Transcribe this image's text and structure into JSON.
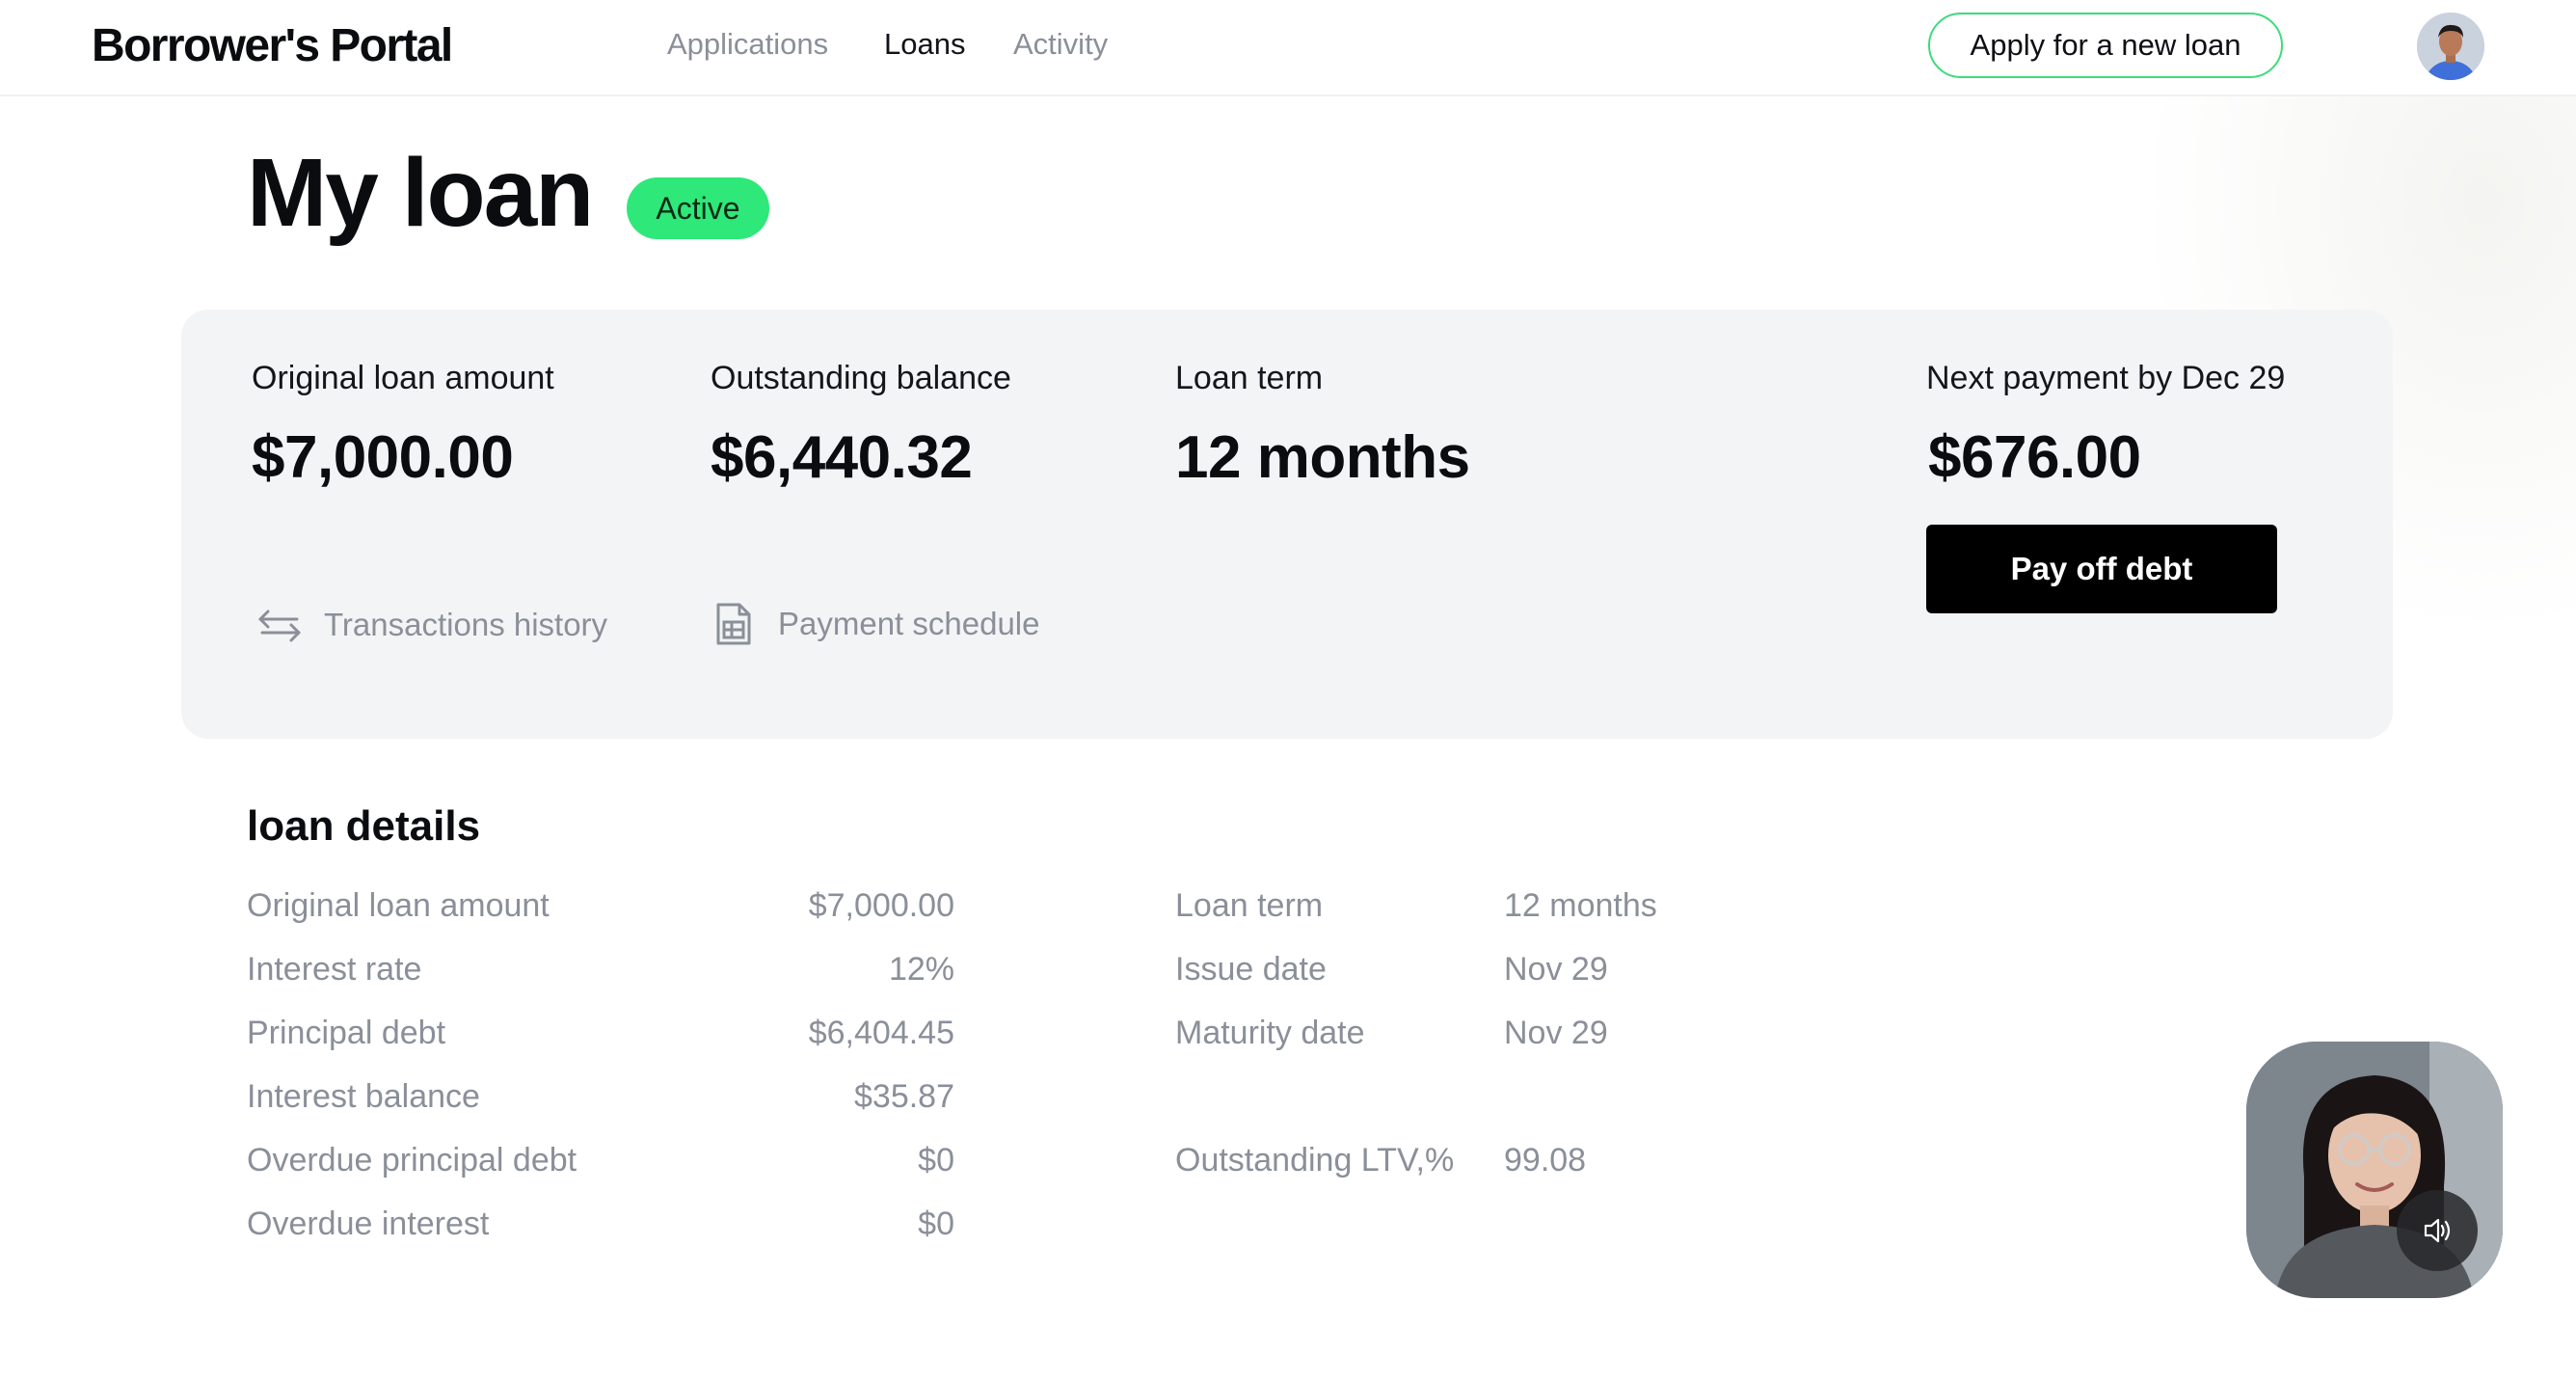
{
  "header": {
    "logo": "Borrower's Portal",
    "nav": [
      {
        "label": "Applications",
        "active": false
      },
      {
        "label": "Loans",
        "active": true
      },
      {
        "label": "Activity",
        "active": false
      }
    ],
    "apply_button": "Apply for a new loan",
    "avatar_icon": "user-avatar"
  },
  "page": {
    "title": "My loan",
    "status": "Active",
    "status_color": "#2ee879"
  },
  "summary": {
    "original_label": "Original loan amount",
    "original_value": "$7,000.00",
    "outstanding_label": "Outstanding balance",
    "outstanding_value": "$6,440.32",
    "term_label": "Loan term",
    "term_value": "12 months",
    "next_payment_label": "Next payment by Dec 29",
    "next_payment_value": "$676.00",
    "pay_off_button": "Pay off debt",
    "transactions_link": "Transactions history",
    "transactions_icon": "transfer-arrows-icon",
    "schedule_link": "Payment schedule",
    "schedule_icon": "document-table-icon"
  },
  "details": {
    "heading": "loan details",
    "left": [
      {
        "label": "Original loan amount",
        "value": "$7,000.00"
      },
      {
        "label": "Interest rate",
        "value": "12%"
      },
      {
        "label": "Principal debt",
        "value": "$6,404.45"
      },
      {
        "label": "Interest balance",
        "value": "$35.87"
      },
      {
        "label": "Overdue principal debt",
        "value": "$0"
      },
      {
        "label": "Overdue interest",
        "value": "$0"
      }
    ],
    "right": [
      {
        "label": "Loan term",
        "value": "12 months"
      },
      {
        "label": "Issue date",
        "value": "Nov 29"
      },
      {
        "label": "Maturity date",
        "value": "Nov 29"
      },
      {
        "label": "Outstanding LTV,%",
        "value": "99.08"
      }
    ]
  },
  "video_widget": {
    "icon": "speaker-icon"
  },
  "colors": {
    "accent_green": "#3ddb7c",
    "muted_text": "#8a8f99",
    "card_bg": "#f3f4f5"
  }
}
